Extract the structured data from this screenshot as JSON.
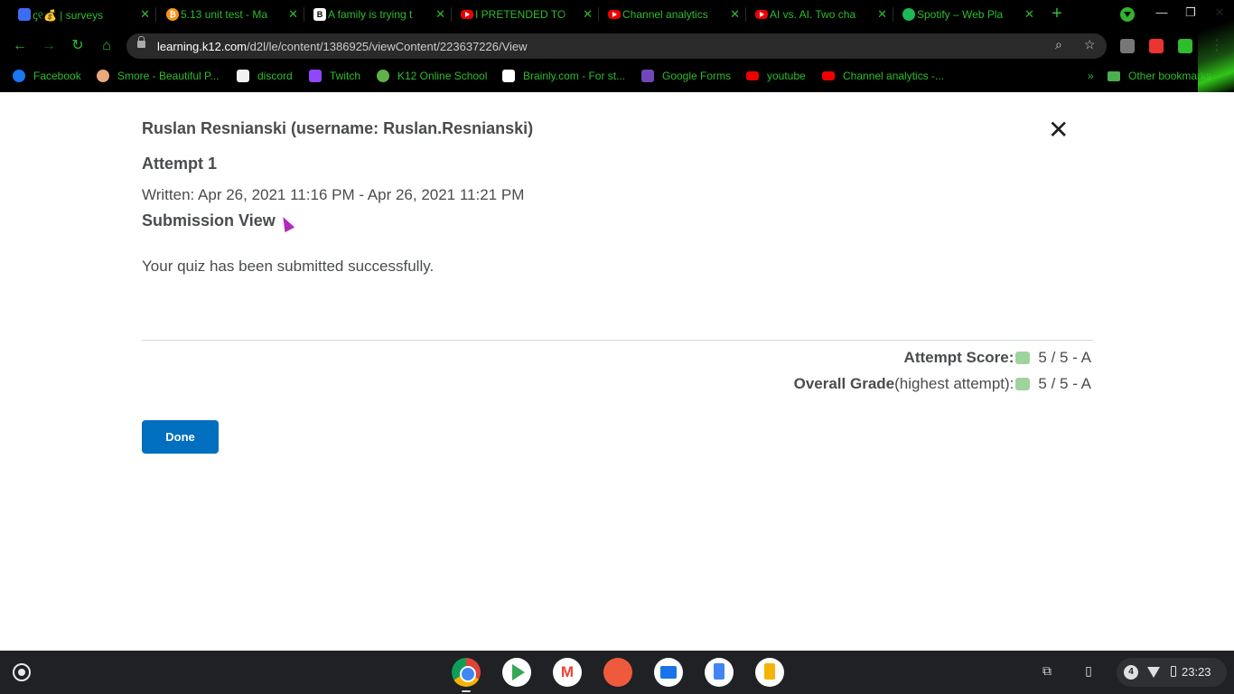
{
  "browser": {
    "tabs": [
      {
        "title": "ꞔ୧💰 | surveys",
        "icon": "survey-favicon"
      },
      {
        "title": "5.13 unit test - Ma",
        "icon": "bitcoin-favicon"
      },
      {
        "title": "A family is trying t",
        "icon": "brainly-favicon"
      },
      {
        "title": "I PRETENDED TO",
        "icon": "youtube-favicon"
      },
      {
        "title": "Channel analytics",
        "icon": "youtube-favicon"
      },
      {
        "title": "AI vs. AI. Two cha",
        "icon": "youtube-favicon"
      },
      {
        "title": "Spotify – Web Pla",
        "icon": "spotify-favicon"
      }
    ],
    "url_host": "learning.k12.com",
    "url_path": "/d2l/le/content/1386925/viewContent/223637226/View",
    "bookmarks": [
      {
        "label": "Facebook"
      },
      {
        "label": "Smore - Beautiful P..."
      },
      {
        "label": "discord"
      },
      {
        "label": "Twitch"
      },
      {
        "label": "K12 Online School"
      },
      {
        "label": "Brainly.com - For st..."
      },
      {
        "label": "Google Forms"
      },
      {
        "label": "youtube"
      },
      {
        "label": "Channel analytics -..."
      }
    ],
    "other_bookmarks": "Other bookmarks",
    "accent": "#2dbd2d"
  },
  "page": {
    "user_line": "Ruslan Resnianski (username: Ruslan.Resnianski)",
    "attempt": "Attempt 1",
    "written": "Written: Apr 26, 2021 11:16 PM - Apr 26, 2021 11:21 PM",
    "submission_view": "Submission View",
    "message": "Your quiz has been submitted successfully.",
    "attempt_score_label": "Attempt Score:",
    "attempt_score_value": "5 / 5 - A",
    "overall_label": "Overall Grade",
    "overall_sub": " (highest attempt):",
    "overall_value": "5 / 5 - A",
    "done_label": "Done",
    "primary_color": "#006fbf"
  },
  "shelf": {
    "apps": [
      "chrome",
      "play-store",
      "gmail",
      "paint",
      "files",
      "docs",
      "slides"
    ],
    "notification_count": "4",
    "time": "23:23"
  }
}
